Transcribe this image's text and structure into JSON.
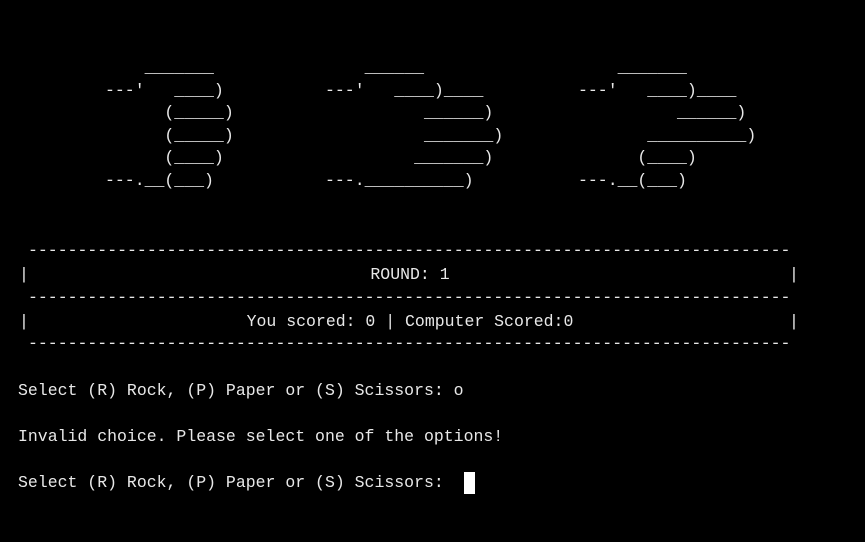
{
  "ascii_art": {
    "rock": "    _______\n---'   ____)\n      (_____)\n      (_____)\n      (____)\n---.__(___)",
    "paper": "    ______\n---'   ____)____\n          ______)\n          _______)\n         _______)\n---.__________)",
    "scissors": "    _______\n---'   ____)____\n          ______)\n       __________)\n      (____)\n---.__(___)"
  },
  "scoreboard": {
    "separator": "------------------------------------------------------------------------------------------",
    "border_char": "|",
    "round_label": "ROUND: 1",
    "score_text": "You scored: 0 | Computer Scored:0"
  },
  "console": {
    "prompt_1": "Select (R) Rock, (P) Paper or (S) Scissors: o",
    "error": "Invalid choice. Please select one of the options!",
    "prompt_2": "Select (R) Rock, (P) Paper or (S) Scissors: "
  },
  "colors": {
    "background": "#000000",
    "text": "#e8e8e8",
    "cursor": "#ffffff"
  }
}
